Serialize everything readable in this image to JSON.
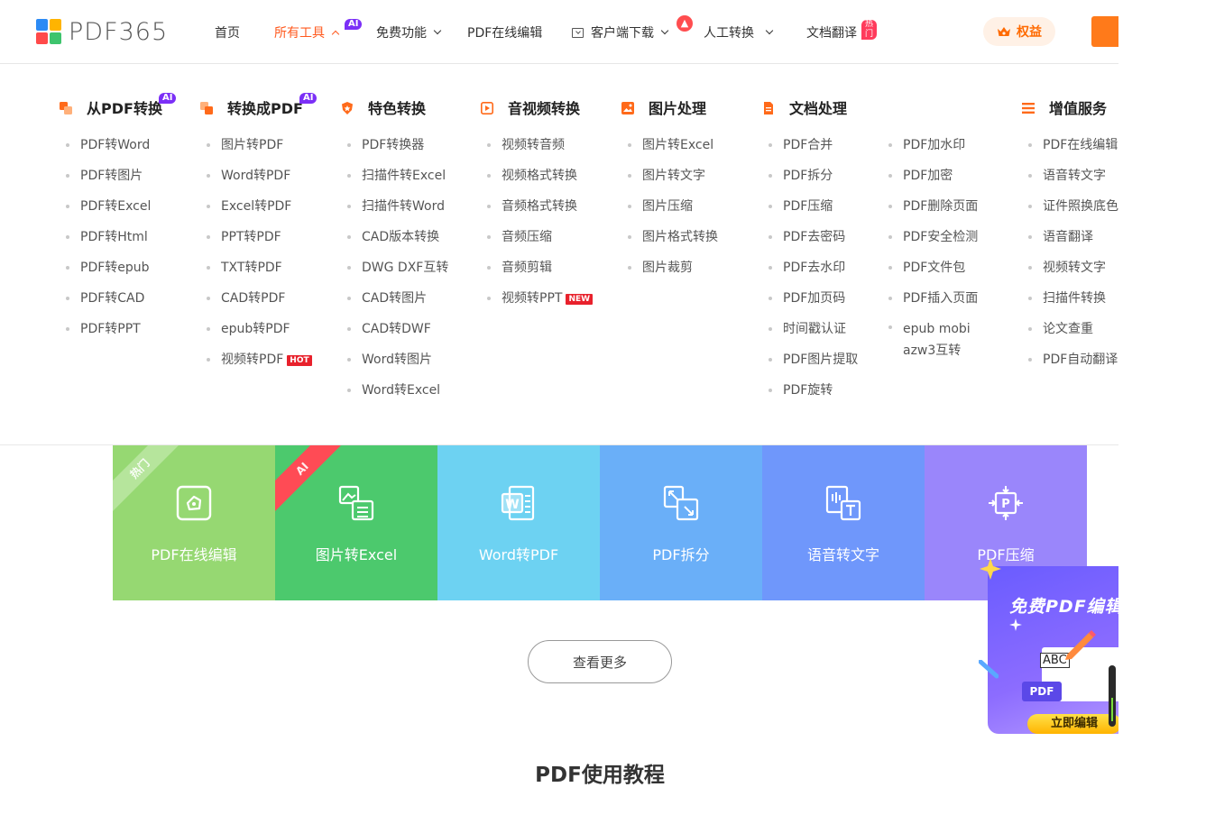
{
  "header": {
    "logo_text": "PDF365",
    "nav": {
      "home": "首页",
      "all_tools": "所有工具",
      "all_tools_badge": "AI",
      "free": "免费功能",
      "online_edit": "PDF在线编辑",
      "download": "客户端下载",
      "manual": "人工转换",
      "translate": "文档翻译",
      "translate_badge": "热门"
    },
    "benefit_label": "权益"
  },
  "menu": {
    "columns": [
      {
        "title": "从PDF转换",
        "badge": "AI",
        "items": [
          "PDF转Word",
          "PDF转图片",
          "PDF转Excel",
          "PDF转Html",
          "PDF转epub",
          "PDF转CAD",
          "PDF转PPT"
        ]
      },
      {
        "title": "转换成PDF",
        "badge": "AI",
        "items": [
          "图片转PDF",
          "Word转PDF",
          "Excel转PDF",
          "PPT转PDF",
          "TXT转PDF",
          "CAD转PDF",
          "epub转PDF",
          "视频转PDF"
        ],
        "hot_tag": "HOT"
      },
      {
        "title": "特色转换",
        "items": [
          "PDF转换器",
          "扫描件转Excel",
          "扫描件转Word",
          "CAD版本转换",
          "DWG DXF互转",
          "CAD转图片",
          "CAD转DWF",
          "Word转图片",
          "Word转Excel"
        ]
      },
      {
        "title": "音视频转换",
        "items": [
          "视频转音频",
          "视频格式转换",
          "音频格式转换",
          "音频压缩",
          "音频剪辑",
          "视频转PPT"
        ],
        "new_tag": "NEW"
      },
      {
        "title": "图片处理",
        "items": [
          "图片转Excel",
          "图片转文字",
          "图片压缩",
          "图片格式转换",
          "图片裁剪"
        ]
      },
      {
        "title": "文档处理",
        "items": [
          "PDF合并",
          "PDF拆分",
          "PDF压缩",
          "PDF去密码",
          "PDF去水印",
          "PDF加页码",
          "时间戳认证",
          "PDF图片提取",
          "PDF旋转"
        ],
        "items2": [
          "PDF加水印",
          "PDF加密",
          "PDF删除页面",
          "PDF安全检测",
          "PDF文件包",
          "PDF插入页面",
          "epub mobi azw3互转"
        ]
      },
      {
        "title": "增值服务",
        "items": [
          "PDF在线编辑",
          "语音转文字",
          "证件照换底色",
          "语音翻译",
          "视频转文字",
          "扫描件转换",
          "论文查重",
          "PDF自动翻译"
        ]
      }
    ]
  },
  "cards": [
    {
      "label": "PDF在线编辑",
      "ribbon": "热门",
      "color": "#96d872"
    },
    {
      "label": "图片转Excel",
      "ribbon": "AI",
      "color": "#4cc96d"
    },
    {
      "label": "Word转PDF",
      "color": "#6dd2f2"
    },
    {
      "label": "PDF拆分",
      "color": "#6aaff8"
    },
    {
      "label": "语音转文字",
      "color": "#6f97fb"
    },
    {
      "label": "PDF压缩",
      "color": "#9a86fb"
    }
  ],
  "more_button": "查看更多",
  "section_title": "PDF使用教程",
  "promo": {
    "title": "免费PDF编辑",
    "doc_text": "ABC",
    "pdf_label": "PDF",
    "button": "立即编辑"
  },
  "colors": {
    "accent": "#ff5a1f",
    "ai_badge": "#7b2ff7",
    "hot_badge": "#ff3b5c"
  }
}
